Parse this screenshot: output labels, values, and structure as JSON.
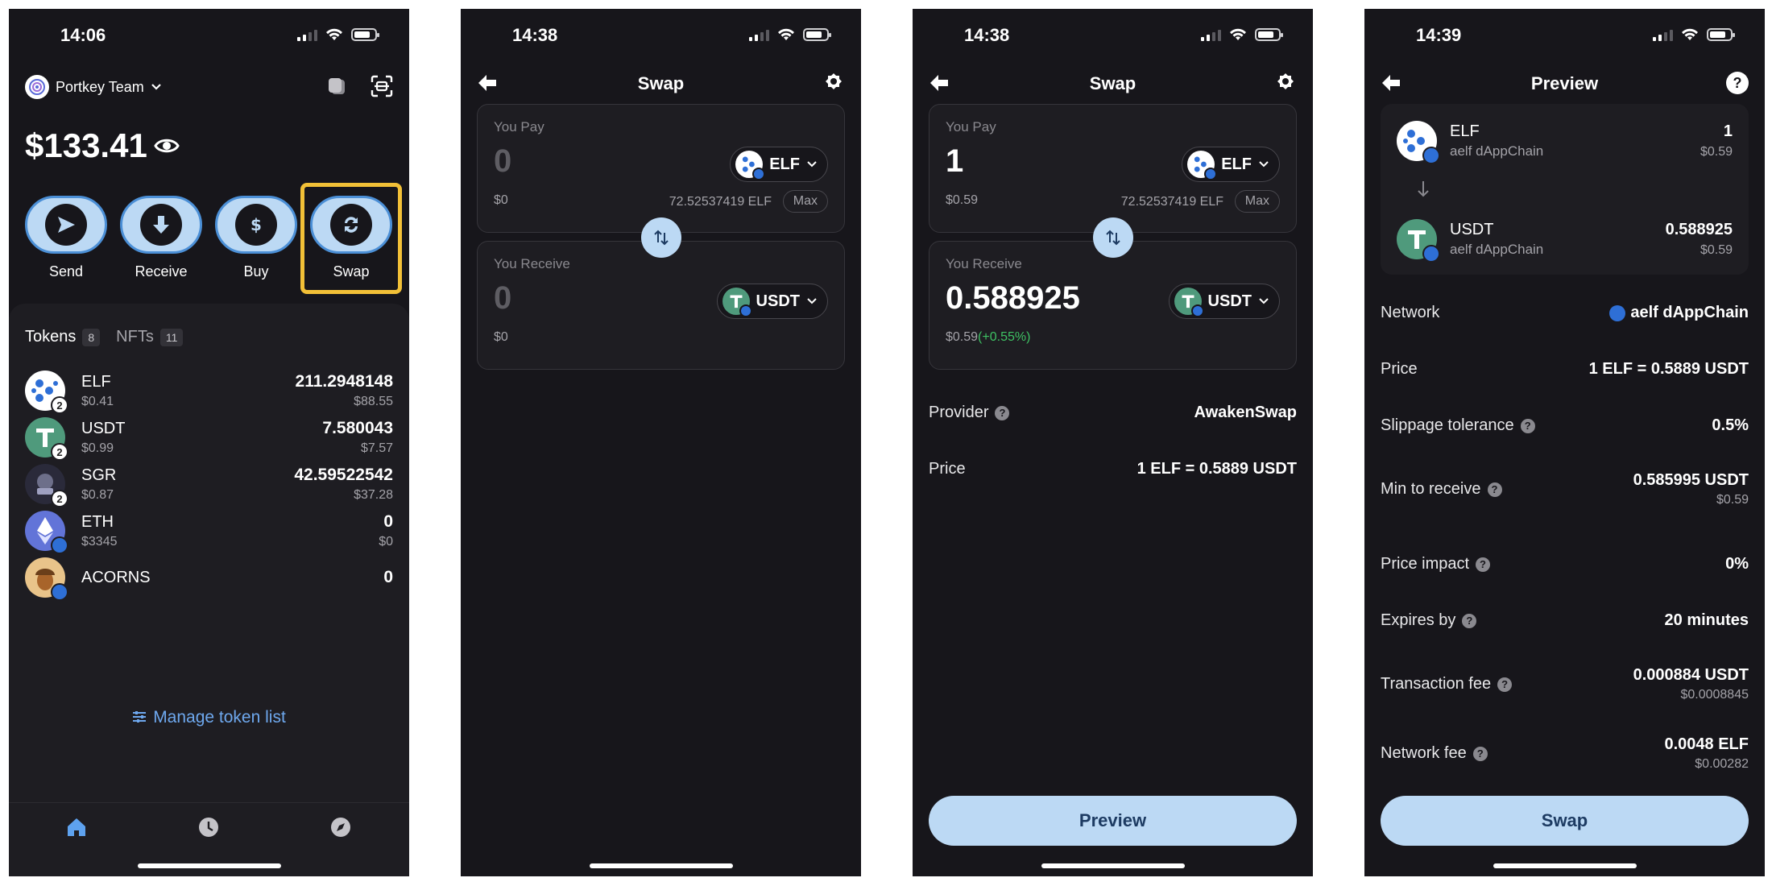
{
  "screen1": {
    "time": "14:06",
    "wallet_name": "Portkey Team",
    "balance": "$133.41",
    "actions": [
      {
        "label": "Send"
      },
      {
        "label": "Receive"
      },
      {
        "label": "Buy"
      },
      {
        "label": "Swap"
      }
    ],
    "tabs": [
      {
        "label": "Tokens",
        "count": "8"
      },
      {
        "label": "NFTs",
        "count": "11"
      }
    ],
    "tokens": [
      {
        "symbol": "ELF",
        "price": "$0.41",
        "amount": "211.2948148",
        "value": "$88.55",
        "badge": "2",
        "color": "#ffffff"
      },
      {
        "symbol": "USDT",
        "price": "$0.99",
        "amount": "7.580043",
        "value": "$7.57",
        "badge": "2",
        "color": "#4f9a7c"
      },
      {
        "symbol": "SGR",
        "price": "$0.87",
        "amount": "42.59522542",
        "value": "$37.28",
        "badge": "2",
        "color": "#2a2a3a"
      },
      {
        "symbol": "ETH",
        "price": "$3345",
        "amount": "0",
        "value": "$0",
        "badge": "",
        "color": "#6274d8"
      },
      {
        "symbol": "ACORNS",
        "price": "",
        "amount": "0",
        "value": "",
        "badge": "",
        "color": "#e9c48a"
      }
    ],
    "manage_label": "Manage token list"
  },
  "screen2": {
    "time": "14:38",
    "title": "Swap",
    "pay": {
      "label": "You Pay",
      "amount": "0",
      "usd": "$0",
      "token": "ELF",
      "balance": "72.52537419 ELF",
      "max": "Max"
    },
    "receive": {
      "label": "You Receive",
      "amount": "0",
      "usd": "$0",
      "token": "USDT"
    }
  },
  "screen3": {
    "time": "14:38",
    "title": "Swap",
    "pay": {
      "label": "You Pay",
      "amount": "1",
      "usd": "$0.59",
      "token": "ELF",
      "balance": "72.52537419 ELF",
      "max": "Max"
    },
    "receive": {
      "label": "You Receive",
      "amount": "0.588925",
      "usd": "$0.59",
      "change": "(+0.55%)",
      "token": "USDT"
    },
    "provider_label": "Provider",
    "provider_value": "AwakenSwap",
    "price_label": "Price",
    "price_value": "1 ELF = 0.5889 USDT",
    "button": "Preview"
  },
  "screen4": {
    "time": "14:39",
    "title": "Preview",
    "from": {
      "symbol": "ELF",
      "chain": "aelf dAppChain",
      "amount": "1",
      "usd": "$0.59"
    },
    "to": {
      "symbol": "USDT",
      "chain": "aelf dAppChain",
      "amount": "0.588925",
      "usd": "$0.59"
    },
    "rows": {
      "network": {
        "label": "Network",
        "value": "aelf dAppChain"
      },
      "price": {
        "label": "Price",
        "value": "1 ELF = 0.5889 USDT"
      },
      "slippage": {
        "label": "Slippage tolerance",
        "value": "0.5%"
      },
      "min_receive": {
        "label": "Min to receive",
        "value": "0.585995 USDT",
        "sub": "$0.59"
      },
      "impact": {
        "label": "Price impact",
        "value": "0%"
      },
      "expires": {
        "label": "Expires by",
        "value": "20 minutes"
      },
      "tx_fee": {
        "label": "Transaction fee",
        "value": "0.000884 USDT",
        "sub": "$0.0008845"
      },
      "net_fee": {
        "label": "Network fee",
        "value": "0.0048 ELF",
        "sub": "$0.00282"
      }
    },
    "button": "Swap"
  }
}
